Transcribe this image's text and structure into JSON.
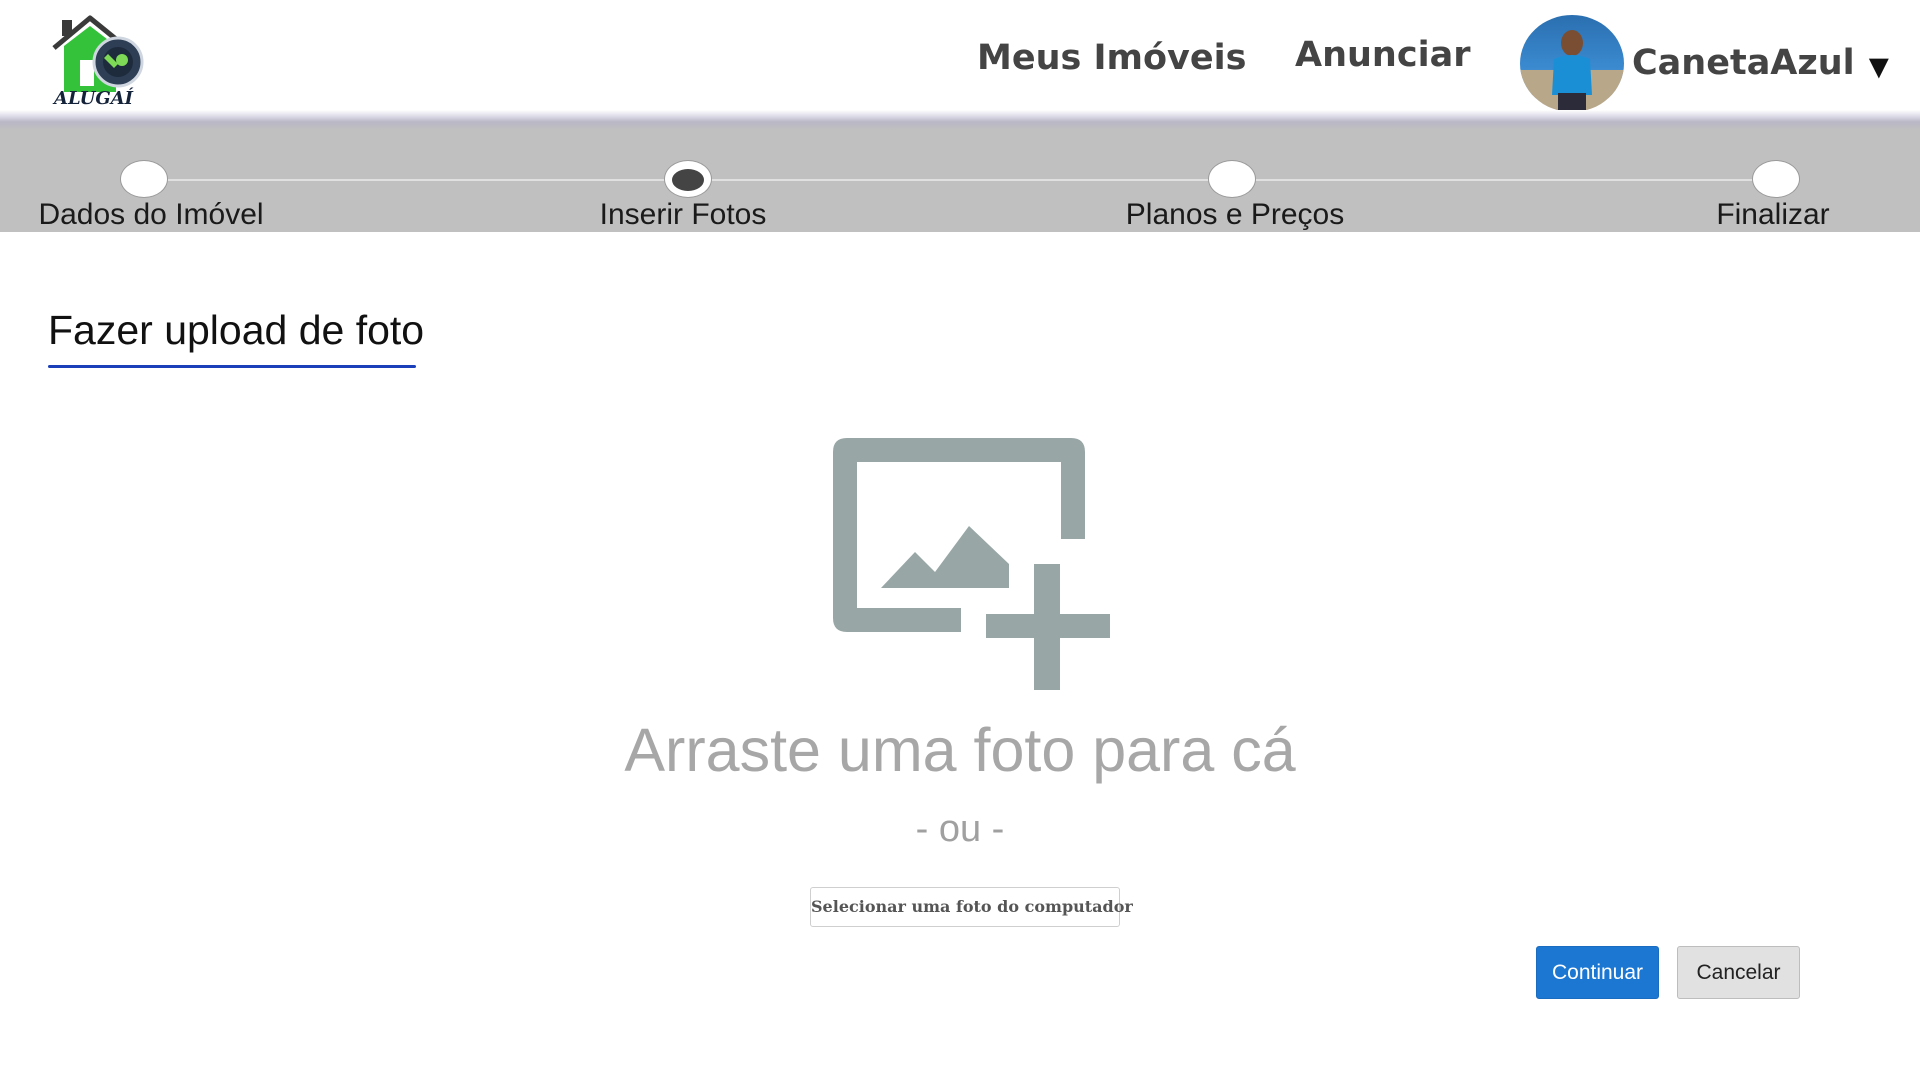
{
  "header": {
    "logo_text": "ALUGAÍ",
    "nav": [
      {
        "label": "Meus Imóveis"
      },
      {
        "label": "Anunciar"
      }
    ],
    "user": {
      "name": "CanetaAzul",
      "caret": "▼"
    }
  },
  "stepper": {
    "steps": [
      {
        "label": "Dados do Imóvel",
        "active": false
      },
      {
        "label": "Inserir Fotos",
        "active": true
      },
      {
        "label": "Planos e Preços",
        "active": false
      },
      {
        "label": "Finalizar",
        "active": false
      }
    ]
  },
  "section": {
    "title": "Fazer upload de foto"
  },
  "upload": {
    "icon": "add-photo-icon",
    "drag_text": "Arraste uma foto para cá",
    "or_text": "- ou -",
    "select_label": "Selecionar uma foto do computador"
  },
  "actions": {
    "continue_label": "Continuar",
    "cancel_label": "Cancelar"
  },
  "colors": {
    "accent": "#1c77d2",
    "underline": "#1a3fb8",
    "stepper_bg": "#c0c0c0",
    "icon_gray": "#98a6a6"
  }
}
